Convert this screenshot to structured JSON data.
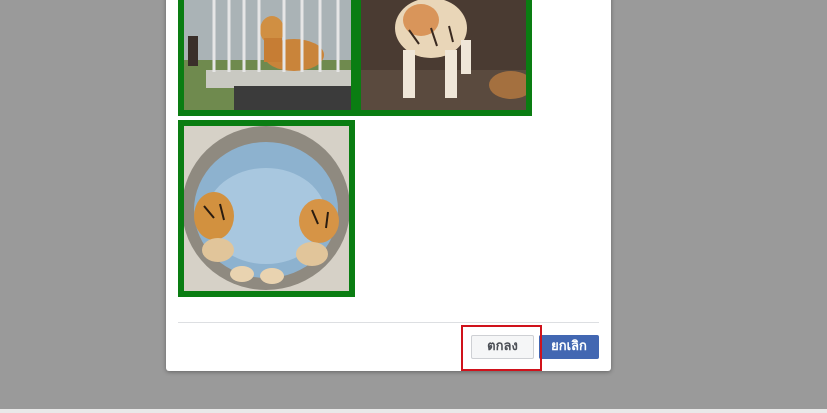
{
  "colors": {
    "backdrop": "#9a9a9a",
    "selection_border": "#0a7d12",
    "highlight_box": "#d0121b",
    "primary_button": "#4267b2"
  },
  "images": [
    {
      "name": "tiger-in-cage",
      "selected": true
    },
    {
      "name": "white-tiger-walking",
      "selected": true
    },
    {
      "name": "two-tigers-in-water",
      "selected": true
    }
  ],
  "footer": {
    "ok_label": "ตกลง",
    "cancel_label": "ยกเลิก"
  }
}
